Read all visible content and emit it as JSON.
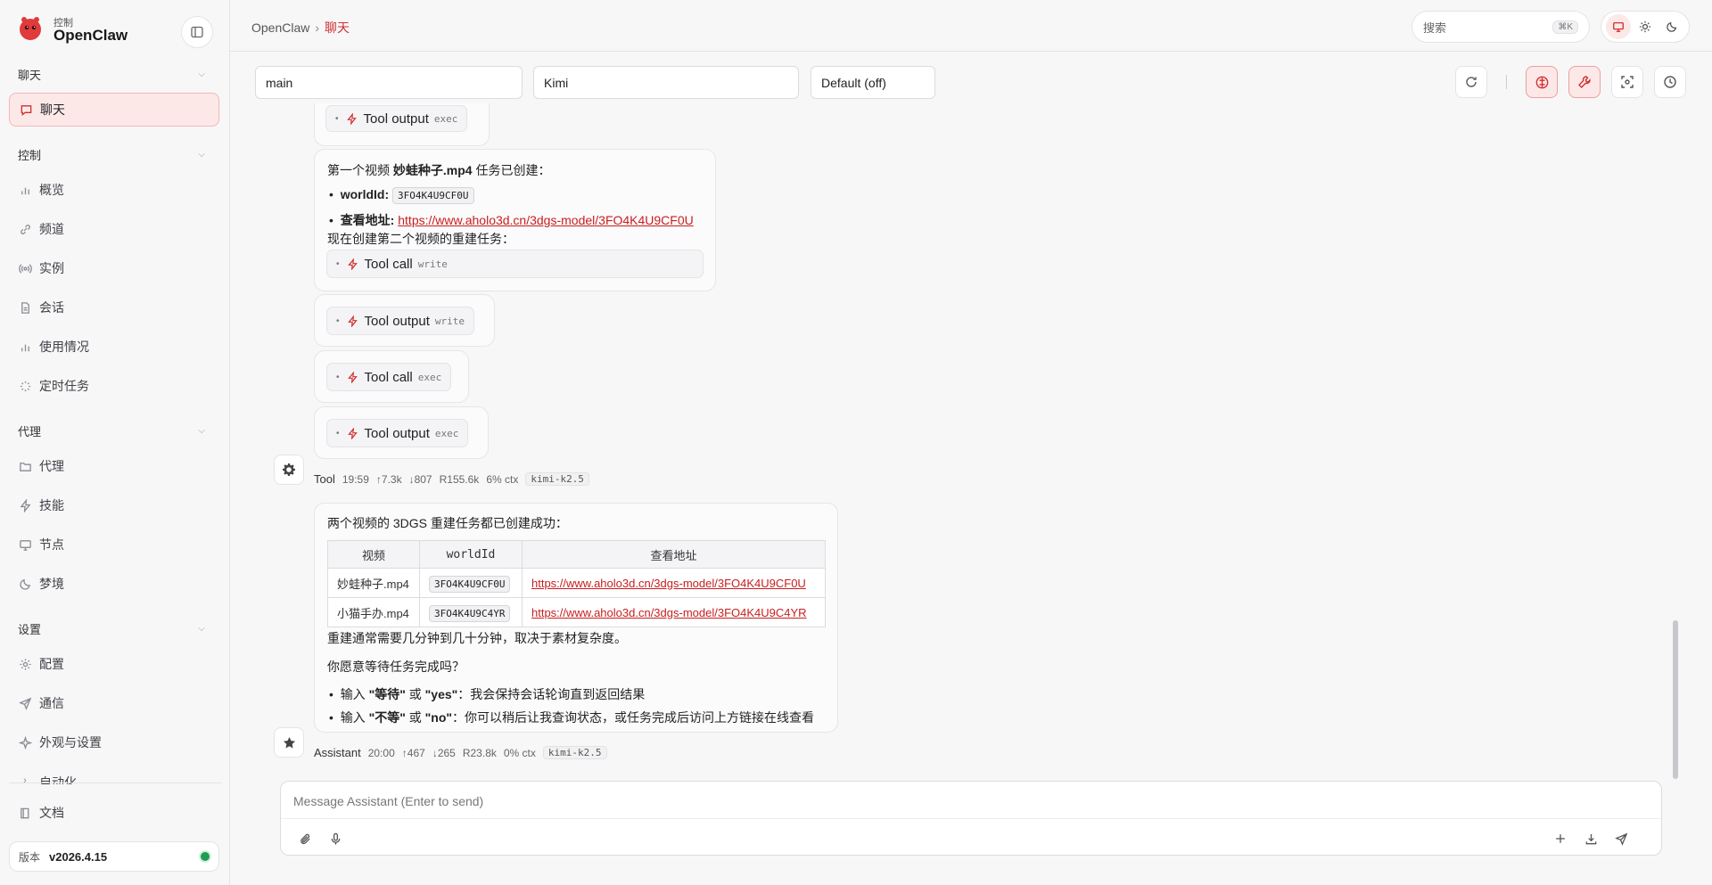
{
  "brand": {
    "small": "控制",
    "name": "OpenClaw"
  },
  "sidebar": {
    "groups": [
      {
        "label": "聊天"
      },
      {
        "label": "控制"
      },
      {
        "label": "代理"
      },
      {
        "label": "设置"
      }
    ],
    "items": {
      "chat": "聊天",
      "overview": "概览",
      "channels": "频道",
      "instances": "实例",
      "sessions": "会话",
      "usage": "使用情况",
      "cron": "定时任务",
      "agents": "代理",
      "skills": "技能",
      "nodes": "节点",
      "dreams": "梦境",
      "config": "配置",
      "comms": "通信",
      "appearance": "外观与设置",
      "automation": "自动化",
      "docs": "文档"
    },
    "version": {
      "label": "版本",
      "value": "v2026.4.15"
    }
  },
  "header": {
    "breadcrumb_root": "OpenClaw",
    "breadcrumb_sep": "›",
    "breadcrumb_current": "聊天",
    "search_placeholder": "搜索",
    "search_shortcut": "⌘K"
  },
  "toolbar": {
    "session": "main",
    "model": "Kimi",
    "thinking": "Default (off)"
  },
  "chat": {
    "tool_chips": {
      "output": "Tool output",
      "call": "Tool call",
      "exec": "exec",
      "write": "write"
    },
    "msg1": {
      "line1_a": "第一个视频 ",
      "line1_b": "妙蛙种子.mp4",
      "line1_c": " 任务已创建：",
      "world_label": "worldId:",
      "world_value": "3FO4K4U9CF0U",
      "url_label": "查看地址:",
      "url_value": "https://www.aholo3d.cn/3dgs-model/3FO4K4U9CF0U",
      "line4": "现在创建第二个视频的重建任务："
    },
    "tool_meta": {
      "who": "Tool",
      "time": "19:59",
      "up": "↑7.3k",
      "down": "↓807",
      "r": "R155.6k",
      "ctx": "6% ctx",
      "model": "kimi-k2.5"
    },
    "msg2": {
      "intro": "两个视频的 3DGS 重建任务都已创建成功：",
      "table_headers": [
        "视频",
        "worldId",
        "查看地址"
      ],
      "rows": [
        {
          "video": "妙蛙种子.mp4",
          "id": "3FO4K4U9CF0U",
          "url": "https://www.aholo3d.cn/3dgs-model/3FO4K4U9CF0U"
        },
        {
          "video": "小猫手办.mp4",
          "id": "3FO4K4U9C4YR",
          "url": "https://www.aholo3d.cn/3dgs-model/3FO4K4U9C4YR"
        }
      ],
      "note": "重建通常需要几分钟到几十分钟，取决于素材复杂度。",
      "question": "你愿意等待任务完成吗？",
      "b1_pre": "输入 ",
      "b1_a": "\"等待\"",
      "b1_or": " 或 ",
      "b1_b": "\"yes\"",
      "b1_rest": "：我会保持会话轮询直到返回结果",
      "b2_pre": "输入 ",
      "b2_a": "\"不等\"",
      "b2_or": " 或 ",
      "b2_b": "\"no\"",
      "b2_rest": "：你可以稍后让我查询状态，或任务完成后访问上方链接在线查看"
    },
    "assistant_meta": {
      "who": "Assistant",
      "time": "20:00",
      "up": "↑467",
      "down": "↓265",
      "r": "R23.8k",
      "ctx": "0% ctx",
      "model": "kimi-k2.5"
    }
  },
  "composer": {
    "placeholder": "Message Assistant (Enter to send)"
  },
  "colors": {
    "accent": "#d12f2f",
    "accent_bg": "#fde8e8",
    "status_green": "#1f9d55"
  }
}
